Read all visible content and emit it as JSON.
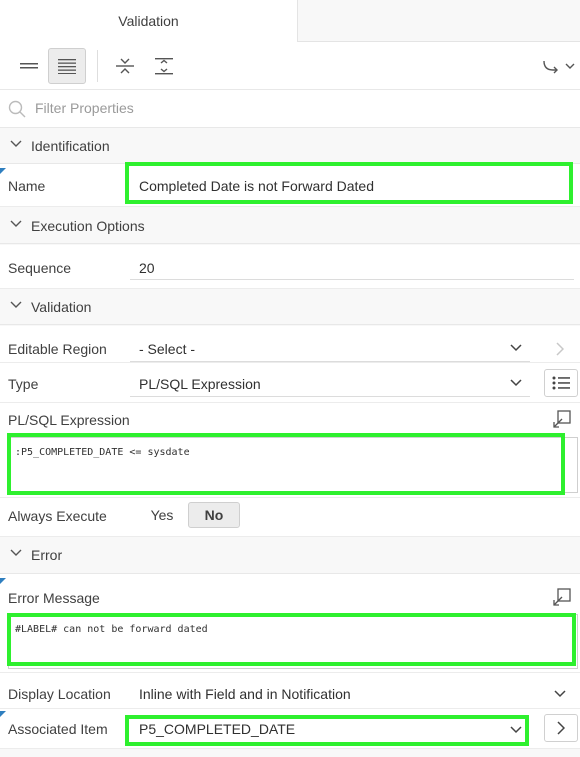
{
  "tabs": {
    "active": "Validation"
  },
  "filter": {
    "placeholder": "Filter Properties"
  },
  "sections": {
    "identification": "Identification",
    "execution": "Execution Options",
    "validation": "Validation",
    "error": "Error"
  },
  "fields": {
    "name": {
      "label": "Name",
      "value": "Completed Date is not Forward Dated"
    },
    "sequence": {
      "label": "Sequence",
      "value": "20"
    },
    "editable_region": {
      "label": "Editable Region",
      "value": "- Select -"
    },
    "type": {
      "label": "Type",
      "value": "PL/SQL Expression"
    },
    "plsql_expression": {
      "label": "PL/SQL Expression",
      "value": ":P5_COMPLETED_DATE <= sysdate"
    },
    "always_execute": {
      "label": "Always Execute",
      "yes": "Yes",
      "no": "No",
      "selected": "No"
    },
    "error_message": {
      "label": "Error Message",
      "value": "#LABEL# can not be forward dated"
    },
    "display_location": {
      "label": "Display Location",
      "value": "Inline with Field and in Notification"
    },
    "associated_item": {
      "label": "Associated Item",
      "value": "P5_COMPLETED_DATE"
    }
  },
  "colors": {
    "highlight": "#2ef02e",
    "required_marker": "#2f7fbf"
  }
}
